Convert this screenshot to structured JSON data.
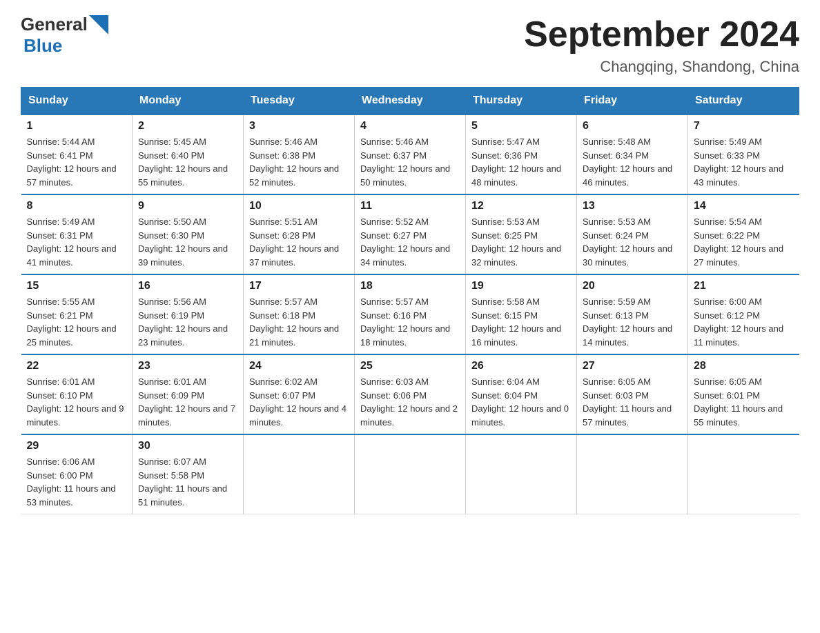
{
  "header": {
    "logo_general": "General",
    "logo_blue": "Blue",
    "month_title": "September 2024",
    "location": "Changqing, Shandong, China"
  },
  "days_of_week": [
    "Sunday",
    "Monday",
    "Tuesday",
    "Wednesday",
    "Thursday",
    "Friday",
    "Saturday"
  ],
  "weeks": [
    [
      {
        "day": "1",
        "sunrise": "5:44 AM",
        "sunset": "6:41 PM",
        "daylight": "12 hours and 57 minutes."
      },
      {
        "day": "2",
        "sunrise": "5:45 AM",
        "sunset": "6:40 PM",
        "daylight": "12 hours and 55 minutes."
      },
      {
        "day": "3",
        "sunrise": "5:46 AM",
        "sunset": "6:38 PM",
        "daylight": "12 hours and 52 minutes."
      },
      {
        "day": "4",
        "sunrise": "5:46 AM",
        "sunset": "6:37 PM",
        "daylight": "12 hours and 50 minutes."
      },
      {
        "day": "5",
        "sunrise": "5:47 AM",
        "sunset": "6:36 PM",
        "daylight": "12 hours and 48 minutes."
      },
      {
        "day": "6",
        "sunrise": "5:48 AM",
        "sunset": "6:34 PM",
        "daylight": "12 hours and 46 minutes."
      },
      {
        "day": "7",
        "sunrise": "5:49 AM",
        "sunset": "6:33 PM",
        "daylight": "12 hours and 43 minutes."
      }
    ],
    [
      {
        "day": "8",
        "sunrise": "5:49 AM",
        "sunset": "6:31 PM",
        "daylight": "12 hours and 41 minutes."
      },
      {
        "day": "9",
        "sunrise": "5:50 AM",
        "sunset": "6:30 PM",
        "daylight": "12 hours and 39 minutes."
      },
      {
        "day": "10",
        "sunrise": "5:51 AM",
        "sunset": "6:28 PM",
        "daylight": "12 hours and 37 minutes."
      },
      {
        "day": "11",
        "sunrise": "5:52 AM",
        "sunset": "6:27 PM",
        "daylight": "12 hours and 34 minutes."
      },
      {
        "day": "12",
        "sunrise": "5:53 AM",
        "sunset": "6:25 PM",
        "daylight": "12 hours and 32 minutes."
      },
      {
        "day": "13",
        "sunrise": "5:53 AM",
        "sunset": "6:24 PM",
        "daylight": "12 hours and 30 minutes."
      },
      {
        "day": "14",
        "sunrise": "5:54 AM",
        "sunset": "6:22 PM",
        "daylight": "12 hours and 27 minutes."
      }
    ],
    [
      {
        "day": "15",
        "sunrise": "5:55 AM",
        "sunset": "6:21 PM",
        "daylight": "12 hours and 25 minutes."
      },
      {
        "day": "16",
        "sunrise": "5:56 AM",
        "sunset": "6:19 PM",
        "daylight": "12 hours and 23 minutes."
      },
      {
        "day": "17",
        "sunrise": "5:57 AM",
        "sunset": "6:18 PM",
        "daylight": "12 hours and 21 minutes."
      },
      {
        "day": "18",
        "sunrise": "5:57 AM",
        "sunset": "6:16 PM",
        "daylight": "12 hours and 18 minutes."
      },
      {
        "day": "19",
        "sunrise": "5:58 AM",
        "sunset": "6:15 PM",
        "daylight": "12 hours and 16 minutes."
      },
      {
        "day": "20",
        "sunrise": "5:59 AM",
        "sunset": "6:13 PM",
        "daylight": "12 hours and 14 minutes."
      },
      {
        "day": "21",
        "sunrise": "6:00 AM",
        "sunset": "6:12 PM",
        "daylight": "12 hours and 11 minutes."
      }
    ],
    [
      {
        "day": "22",
        "sunrise": "6:01 AM",
        "sunset": "6:10 PM",
        "daylight": "12 hours and 9 minutes."
      },
      {
        "day": "23",
        "sunrise": "6:01 AM",
        "sunset": "6:09 PM",
        "daylight": "12 hours and 7 minutes."
      },
      {
        "day": "24",
        "sunrise": "6:02 AM",
        "sunset": "6:07 PM",
        "daylight": "12 hours and 4 minutes."
      },
      {
        "day": "25",
        "sunrise": "6:03 AM",
        "sunset": "6:06 PM",
        "daylight": "12 hours and 2 minutes."
      },
      {
        "day": "26",
        "sunrise": "6:04 AM",
        "sunset": "6:04 PM",
        "daylight": "12 hours and 0 minutes."
      },
      {
        "day": "27",
        "sunrise": "6:05 AM",
        "sunset": "6:03 PM",
        "daylight": "11 hours and 57 minutes."
      },
      {
        "day": "28",
        "sunrise": "6:05 AM",
        "sunset": "6:01 PM",
        "daylight": "11 hours and 55 minutes."
      }
    ],
    [
      {
        "day": "29",
        "sunrise": "6:06 AM",
        "sunset": "6:00 PM",
        "daylight": "11 hours and 53 minutes."
      },
      {
        "day": "30",
        "sunrise": "6:07 AM",
        "sunset": "5:58 PM",
        "daylight": "11 hours and 51 minutes."
      },
      null,
      null,
      null,
      null,
      null
    ]
  ]
}
